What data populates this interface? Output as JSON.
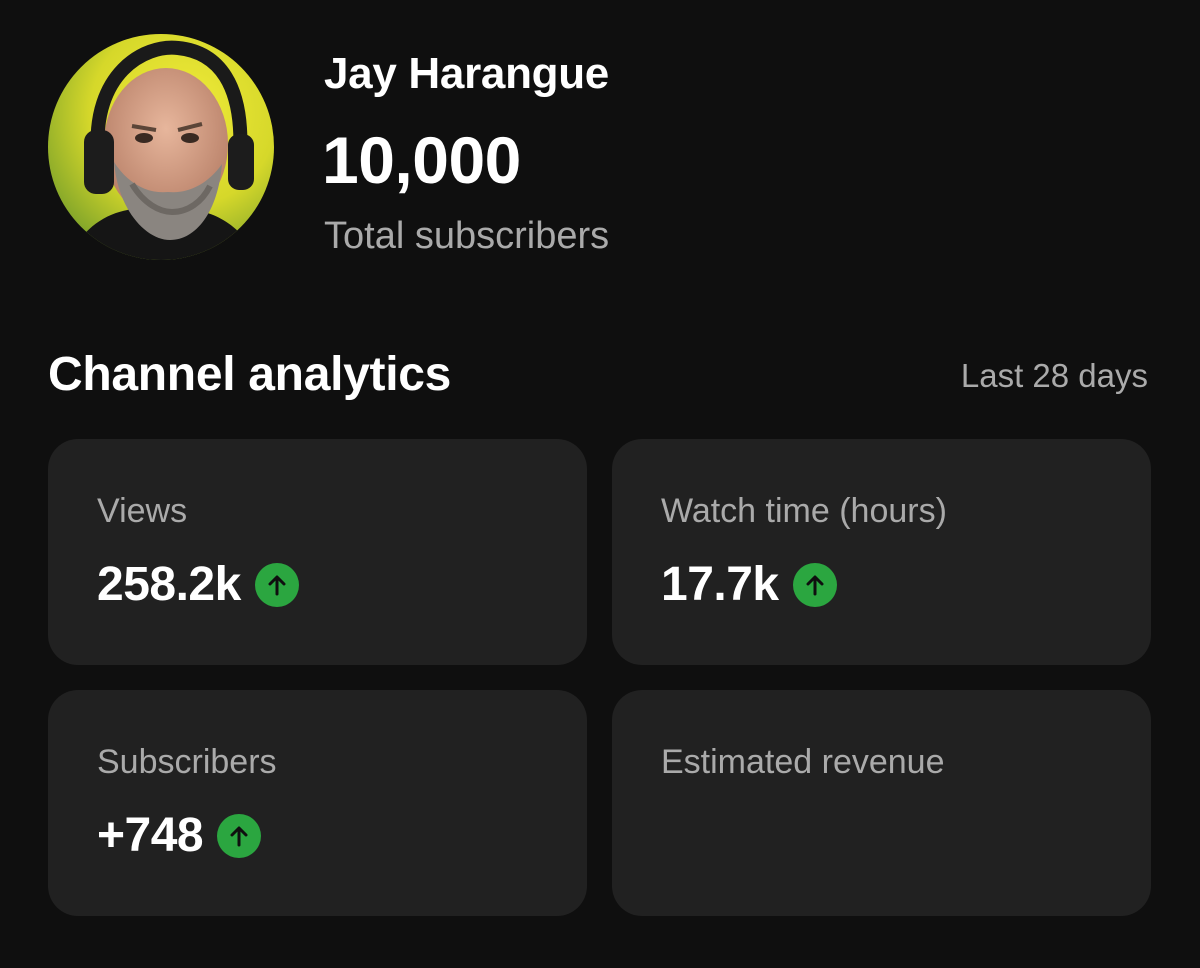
{
  "channel": {
    "name": "Jay Harangue",
    "subscriber_count": "10,000",
    "subscriber_caption": "Total subscribers",
    "avatar_icon": "user-avatar-icon"
  },
  "analytics": {
    "title": "Channel analytics",
    "period": "Last 28 days",
    "trend_up_color": "#2ba640",
    "cards": [
      {
        "label": "Views",
        "value": "258.2k",
        "trend": "up"
      },
      {
        "label": "Watch time (hours)",
        "value": "17.7k",
        "trend": "up"
      },
      {
        "label": "Subscribers",
        "value": "+748",
        "trend": "up"
      },
      {
        "label": "Estimated revenue",
        "value": "",
        "trend": ""
      }
    ]
  }
}
